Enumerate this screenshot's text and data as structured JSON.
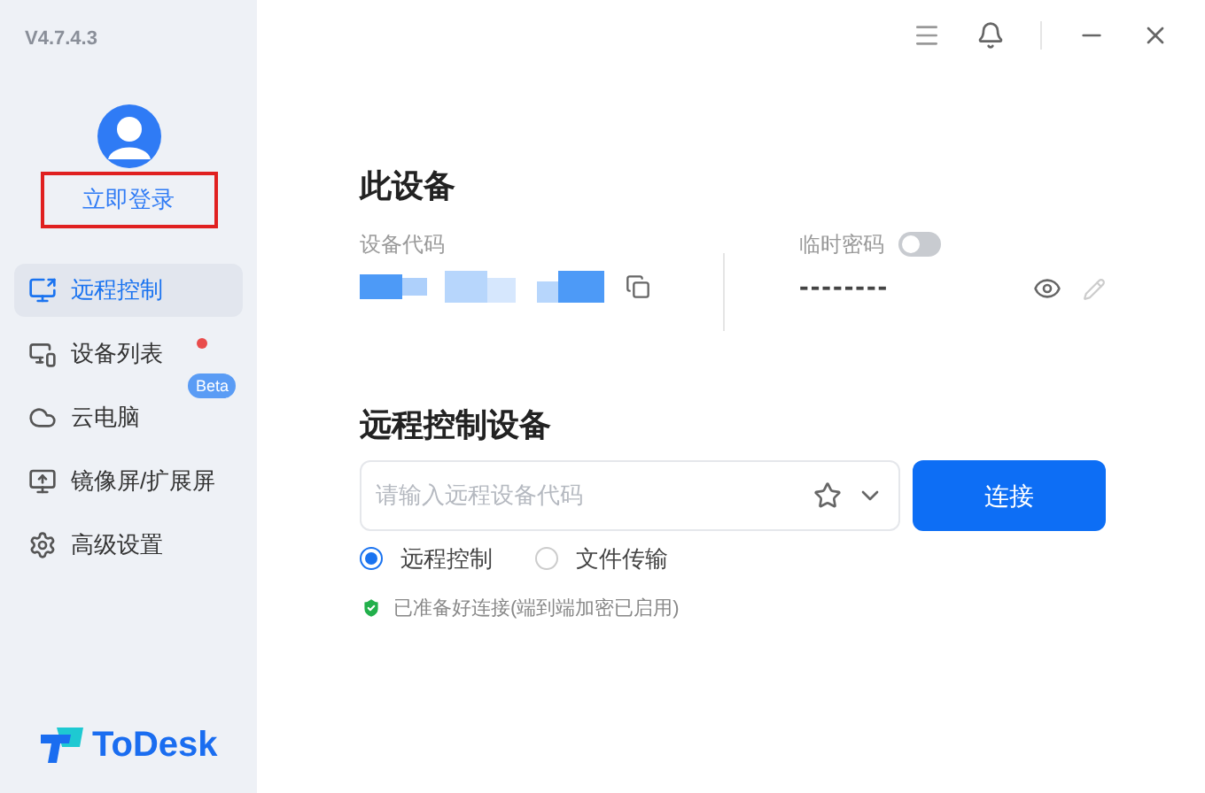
{
  "version": "V4.7.4.3",
  "login": "立即登录",
  "nav": [
    {
      "label": "远程控制",
      "selected": true,
      "kind": "remote",
      "dot": false
    },
    {
      "label": "设备列表",
      "selected": false,
      "kind": "devices",
      "dot": true
    },
    {
      "label": "云电脑",
      "selected": false,
      "kind": "cloud",
      "dot": false,
      "badge": "Beta"
    },
    {
      "label": "镜像屏/扩展屏",
      "selected": false,
      "kind": "mirror",
      "dot": false
    },
    {
      "label": "高级设置",
      "selected": false,
      "kind": "settings",
      "dot": false
    }
  ],
  "brand": "ToDesk",
  "this_device": {
    "title": "此设备",
    "code_label": "设备代码",
    "temp_password_label": "临时密码",
    "temp_password_on": false,
    "password": "--------"
  },
  "remote": {
    "title": "远程控制设备",
    "placeholder": "请输入远程设备代码",
    "connect": "连接",
    "modes": [
      {
        "label": "远程控制",
        "selected": true
      },
      {
        "label": "文件传输",
        "selected": false
      }
    ],
    "status": "已准备好连接(端到端加密已启用)"
  }
}
